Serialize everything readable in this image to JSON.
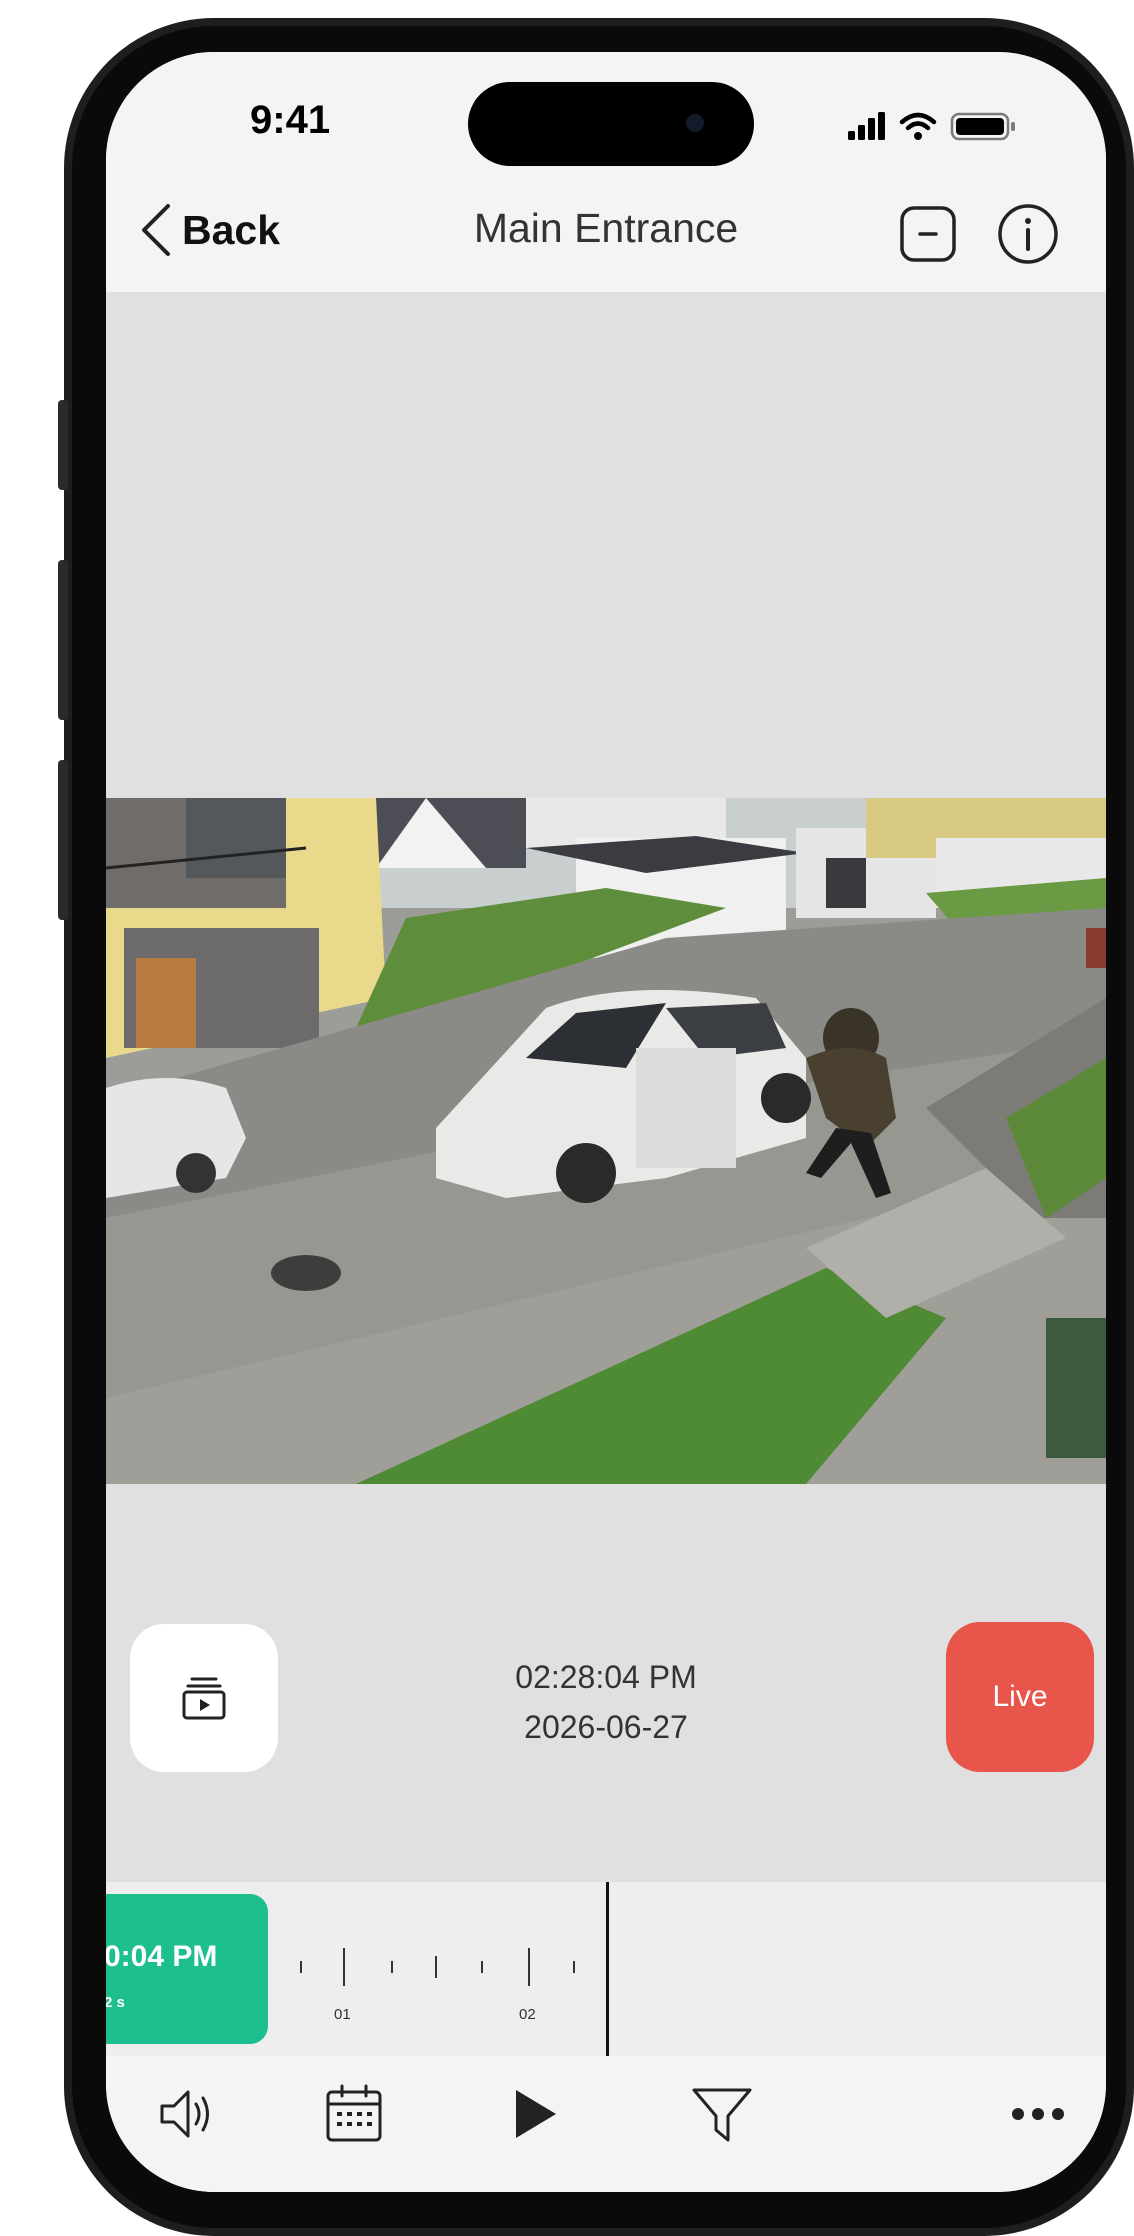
{
  "status_bar": {
    "time": "9:41"
  },
  "nav": {
    "back_label": "Back",
    "title": "Main Entrance"
  },
  "player": {
    "time": "02:28:04 PM",
    "date": "2026-06-27",
    "live_label": "Live"
  },
  "timeline": {
    "event": {
      "time": "0:04 PM",
      "duration": "2 s"
    },
    "ticks": [
      "01",
      "02"
    ]
  },
  "icons": {
    "top": [
      "minus-square-icon",
      "info-icon"
    ],
    "controls": [
      "recordings-icon"
    ],
    "bottom": [
      "speaker-icon",
      "calendar-icon",
      "play-icon",
      "filter-icon",
      "more-icon"
    ]
  },
  "colors": {
    "live": "#e8564b",
    "event": "#1dbf8e"
  }
}
